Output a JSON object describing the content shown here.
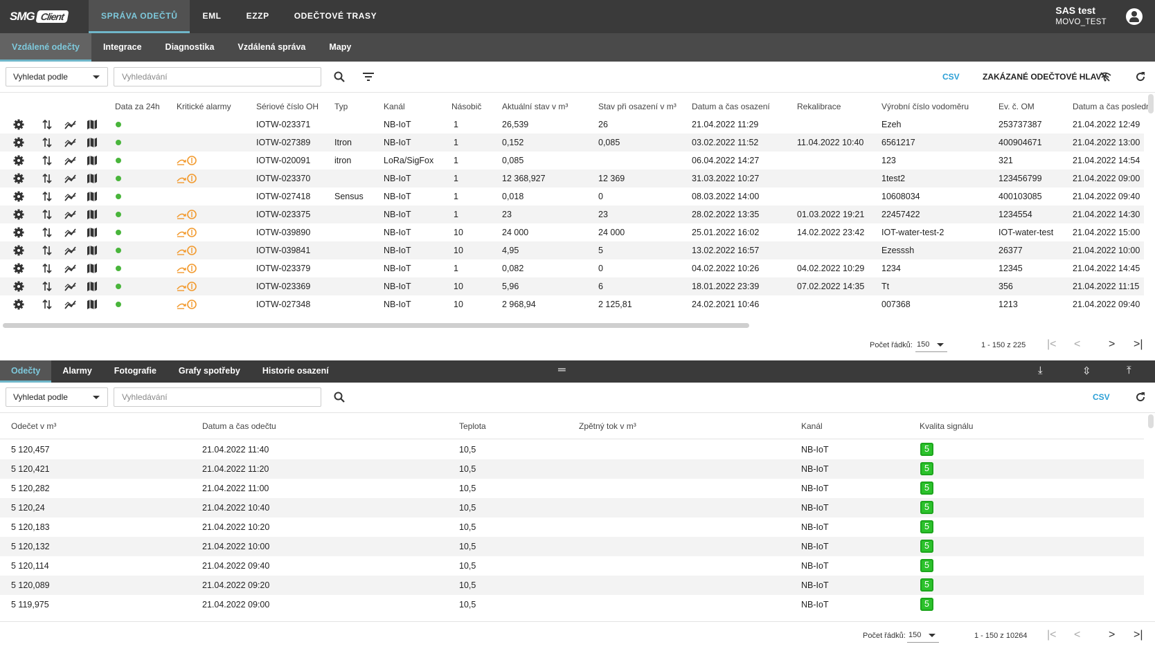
{
  "app": {
    "logo_text": "SMG",
    "logo_box": "Client",
    "user_name": "SAS test",
    "company": "MOVO_TEST"
  },
  "top_nav": [
    "SPRÁVA ODEČTŮ",
    "EML",
    "EZZP",
    "ODEČTOVÉ TRASY"
  ],
  "sub_nav": [
    "Vzdálené odečty",
    "Integrace",
    "Diagnostika",
    "Vzdálená správa",
    "Mapy"
  ],
  "search1": {
    "by": "Vyhledat podle",
    "placeholder": "Vyhledávání",
    "csv": "CSV",
    "disabled_heads": "ZAKÁZANÉ ODEČTOVÉ HLAVY"
  },
  "grid1": {
    "headers": [
      "Data za 24h",
      "Kritické alarmy",
      "Sériové číslo OH",
      "Typ",
      "Kanál",
      "Násobič",
      "Aktuální stav v m³",
      "Stav při osazení v m³",
      "Datum a čas osazení",
      "Rekalibrace",
      "Výrobní číslo vodoměru",
      "Ev. č. OM",
      "Datum a čas posledn"
    ],
    "rows": [
      {
        "alarm": false,
        "serial": "IOTW-023371",
        "type": "",
        "channel": "NB-IoT",
        "mult": "1",
        "current": "26,539",
        "install": "26",
        "date": "21.04.2022 11:29",
        "recal": "",
        "meter": "Ezeh",
        "ev": "253737387",
        "last": "21.04.2022 12:49"
      },
      {
        "alarm": false,
        "serial": "IOTW-027389",
        "type": "Itron",
        "channel": "NB-IoT",
        "mult": "1",
        "current": "0,152",
        "install": "0,085",
        "date": "03.02.2022 11:52",
        "recal": "11.04.2022 10:40",
        "meter": "6561217",
        "ev": "400904671",
        "last": "21.04.2022 13:00"
      },
      {
        "alarm": true,
        "serial": "IOTW-020091",
        "type": "itron",
        "channel": "LoRa/SigFox",
        "mult": "1",
        "current": "0,085",
        "install": "",
        "date": "06.04.2022 14:27",
        "recal": "",
        "meter": "123",
        "ev": "321",
        "last": "21.04.2022 14:54"
      },
      {
        "alarm": true,
        "serial": "IOTW-023370",
        "type": "",
        "channel": "NB-IoT",
        "mult": "1",
        "current": "12 368,927",
        "install": "12 369",
        "date": "31.03.2022 10:27",
        "recal": "",
        "meter": "1test2",
        "ev": "123456799",
        "last": "21.04.2022 09:00"
      },
      {
        "alarm": false,
        "serial": "IOTW-027418",
        "type": "Sensus",
        "channel": "NB-IoT",
        "mult": "1",
        "current": "0,018",
        "install": "0",
        "date": "08.03.2022 14:00",
        "recal": "",
        "meter": "10608034",
        "ev": "400103085",
        "last": "21.04.2022 09:40"
      },
      {
        "alarm": true,
        "serial": "IOTW-023375",
        "type": "",
        "channel": "NB-IoT",
        "mult": "1",
        "current": "23",
        "install": "23",
        "date": "28.02.2022 13:35",
        "recal": "01.03.2022 19:21",
        "meter": "22457422",
        "ev": "1234554",
        "last": "21.04.2022 14:30"
      },
      {
        "alarm": true,
        "serial": "IOTW-039890",
        "type": "",
        "channel": "NB-IoT",
        "mult": "10",
        "current": "24 000",
        "install": "24 000",
        "date": "25.01.2022 16:02",
        "recal": "14.02.2022 23:42",
        "meter": "IOT-water-test-2",
        "ev": "IOT-water-test",
        "last": "21.04.2022 15:00"
      },
      {
        "alarm": true,
        "serial": "IOTW-039841",
        "type": "",
        "channel": "NB-IoT",
        "mult": "10",
        "current": "4,95",
        "install": "5",
        "date": "13.02.2022 16:57",
        "recal": "",
        "meter": "Ezesssh",
        "ev": "26377",
        "last": "21.04.2022 10:00"
      },
      {
        "alarm": true,
        "serial": "IOTW-023379",
        "type": "",
        "channel": "NB-IoT",
        "mult": "1",
        "current": "0,082",
        "install": "0",
        "date": "04.02.2022 10:26",
        "recal": "04.02.2022 10:29",
        "meter": "1234",
        "ev": "12345",
        "last": "21.04.2022 14:45"
      },
      {
        "alarm": true,
        "serial": "IOTW-023369",
        "type": "",
        "channel": "NB-IoT",
        "mult": "10",
        "current": "5,96",
        "install": "6",
        "date": "18.01.2022 23:39",
        "recal": "07.02.2022 14:35",
        "meter": "Tt",
        "ev": "356",
        "last": "21.04.2022 11:15"
      },
      {
        "alarm": true,
        "serial": "IOTW-027348",
        "type": "",
        "channel": "NB-IoT",
        "mult": "10",
        "current": "2 968,94",
        "install": "2 125,81",
        "date": "24.02.2021 10:46",
        "recal": "",
        "meter": "007368",
        "ev": "1213",
        "last": "21.04.2022 09:40"
      }
    ]
  },
  "pager1": {
    "label": "Počet řádků:",
    "size": "150",
    "range": "1 - 150 z 225"
  },
  "bottom_tabs": [
    "Odečty",
    "Alarmy",
    "Fotografie",
    "Grafy spotřeby",
    "Historie osazení"
  ],
  "search2": {
    "by": "Vyhledat podle",
    "placeholder": "Vyhledávání",
    "csv": "CSV"
  },
  "grid2": {
    "headers": [
      "Odečet v m³",
      "Datum a čas odečtu",
      "Teplota",
      "Zpětný tok v m³",
      "Kanál",
      "Kvalita signálu"
    ],
    "rows": [
      {
        "value": "5 120,457",
        "date": "21.04.2022 11:40",
        "temp": "10,5",
        "back": "",
        "channel": "NB-IoT",
        "q": "5"
      },
      {
        "value": "5 120,421",
        "date": "21.04.2022 11:20",
        "temp": "10,5",
        "back": "",
        "channel": "NB-IoT",
        "q": "5"
      },
      {
        "value": "5 120,282",
        "date": "21.04.2022 11:00",
        "temp": "10,5",
        "back": "",
        "channel": "NB-IoT",
        "q": "5"
      },
      {
        "value": "5 120,24",
        "date": "21.04.2022 10:40",
        "temp": "10,5",
        "back": "",
        "channel": "NB-IoT",
        "q": "5"
      },
      {
        "value": "5 120,183",
        "date": "21.04.2022 10:20",
        "temp": "10,5",
        "back": "",
        "channel": "NB-IoT",
        "q": "5"
      },
      {
        "value": "5 120,132",
        "date": "21.04.2022 10:00",
        "temp": "10,5",
        "back": "",
        "channel": "NB-IoT",
        "q": "5"
      },
      {
        "value": "5 120,114",
        "date": "21.04.2022 09:40",
        "temp": "10,5",
        "back": "",
        "channel": "NB-IoT",
        "q": "5"
      },
      {
        "value": "5 120,089",
        "date": "21.04.2022 09:20",
        "temp": "10,5",
        "back": "",
        "channel": "NB-IoT",
        "q": "5"
      },
      {
        "value": "5 119,975",
        "date": "21.04.2022 09:00",
        "temp": "10,5",
        "back": "",
        "channel": "NB-IoT",
        "q": "5"
      }
    ]
  },
  "pager2": {
    "label": "Počet řádků:",
    "size": "150",
    "range": "1 - 150 z 10264"
  },
  "colors": {
    "accent": "#2a9fd6",
    "active_tab": "#7ec9dc",
    "ok": "#49b53b",
    "alarm": "#f29a2e"
  }
}
